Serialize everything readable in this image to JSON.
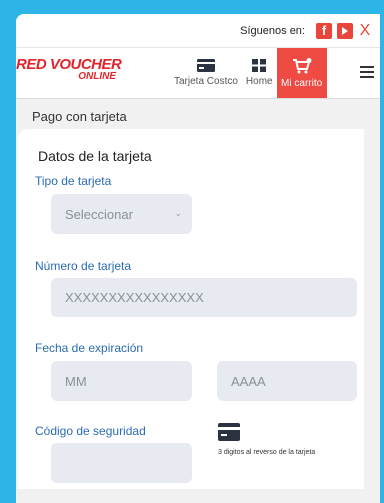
{
  "topbar": {
    "follow_label": "Síguenos en:",
    "facebook_glyph": "f",
    "close_glyph": "X"
  },
  "header": {
    "logo_line1": "RED VOUCHER",
    "logo_line2": "ONLINE",
    "nav": [
      {
        "label": "Tarjeta Costco",
        "icon": "credit-card-icon"
      },
      {
        "label": "Home",
        "icon": "grid-icon"
      },
      {
        "label": "Mi carrito",
        "icon": "cart-icon"
      }
    ],
    "menu_icon": "hamburger-menu-icon"
  },
  "page": {
    "section_title": "Pago con tarjeta"
  },
  "form": {
    "title": "Datos de la tarjeta",
    "card_type": {
      "label": "Tipo de tarjeta",
      "value": "Seleccionar"
    },
    "card_number": {
      "label": "Número de tarjeta",
      "placeholder": "XXXXXXXXXXXXXXXX"
    },
    "expiration": {
      "label": "Fecha de expiración",
      "month_placeholder": "MM",
      "year_placeholder": "AAAA"
    },
    "security_code": {
      "label": "Código de seguridad",
      "hint": "3 digitos al reverso de la tarjeta"
    }
  },
  "colors": {
    "background": "#2cb5e6",
    "brand_red": "#e0262a",
    "cart_red": "#ef4a43",
    "label_blue": "#2b6cb3",
    "field_bg": "#e7ebf1"
  }
}
